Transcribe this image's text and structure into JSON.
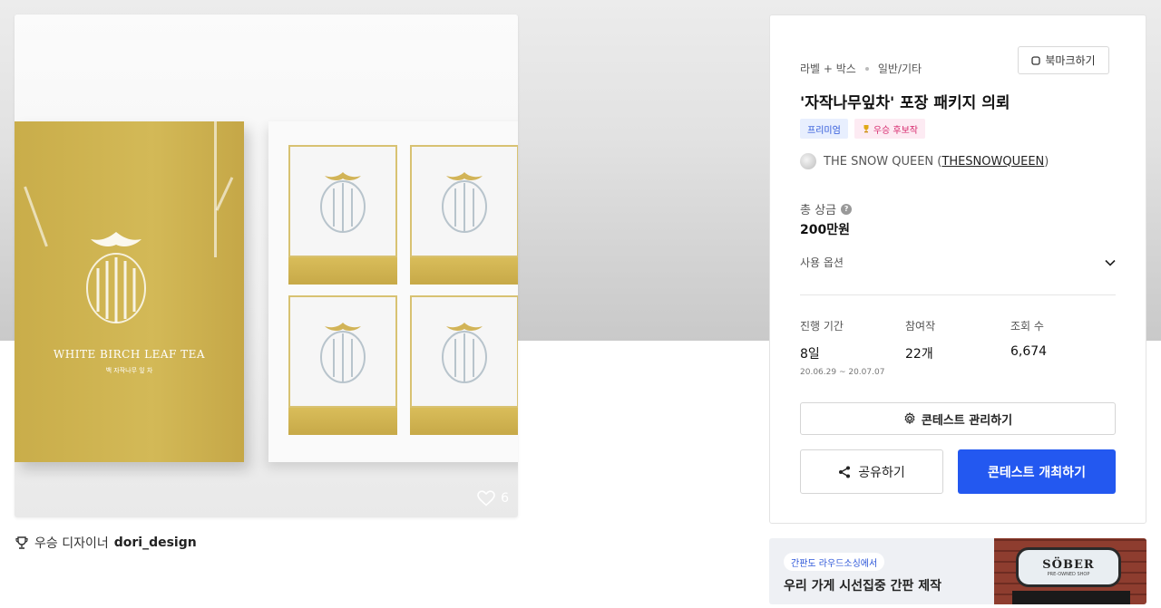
{
  "photo": {
    "box_title": "WHITE BIRCH LEAF TEA",
    "box_subtitle": "백 자작나무 잎 차",
    "like_count": "6",
    "emblem_text": "The Snow Queen",
    "colors": {
      "gold": "#cfb254",
      "white": "#f6f6f6"
    }
  },
  "designer": {
    "label": "우승 디자이너",
    "name": "dori_design"
  },
  "panel": {
    "category_main": "라벨 + 박스",
    "category_sub": "일반/기타",
    "bookmark_label": "북마크하기",
    "title": "'자작나무잎차' 포장 패키지 의뢰",
    "badges": {
      "premium": "프리미엄",
      "winner": "우승 후보작"
    },
    "host_name": "THE SNOW QUEEN (",
    "host_handle": "THESNOWQUEEN",
    "host_close": ")",
    "prize_label": "총 상금",
    "prize_value": "200만원",
    "usage_label": "사용 옵션",
    "stats": {
      "period_label": "진행 기간",
      "period_value": "8일",
      "period_dates": "20.06.29 ~ 20.07.07",
      "entries_label": "참여작",
      "entries_value": "22개",
      "views_label": "조회 수",
      "views_value": "6,674"
    },
    "manage_label": "콘테스트 관리하기",
    "share_label": "공유하기",
    "host_contest_label": "콘테스트 개최하기",
    "accent_color": "#2358f0"
  },
  "ad": {
    "tag": "간판도 라우드소싱에서",
    "headline": "우리 가게 시선집중 간판 제작",
    "sign_text": "SÖBER",
    "sign_sub": "PRE-OWNED SHOP"
  }
}
